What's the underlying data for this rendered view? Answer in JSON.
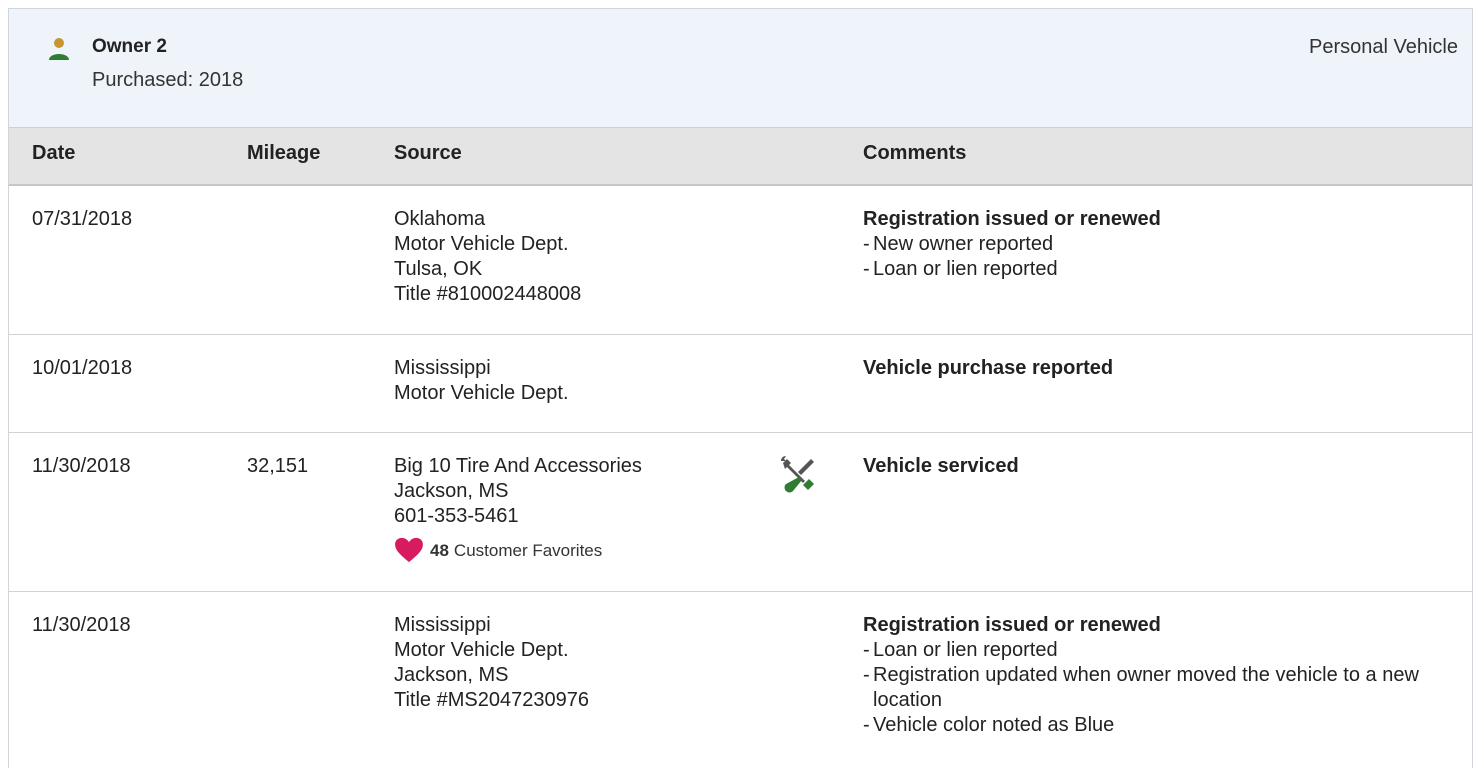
{
  "owner": {
    "title": "Owner 2",
    "purchased": "Purchased: 2018",
    "vehicle_type": "Personal Vehicle",
    "icon": "person-icon"
  },
  "table": {
    "headers": {
      "date": "Date",
      "mileage": "Mileage",
      "source": "Source",
      "comments": "Comments"
    },
    "rows": [
      {
        "date": "07/31/2018",
        "mileage": "",
        "source": [
          "Oklahoma",
          "Motor Vehicle Dept.",
          "Tulsa, OK",
          "Title #810002448008"
        ],
        "comment_title": "Registration issued or renewed",
        "comment_items": [
          "New owner reported",
          "Loan or lien reported"
        ]
      },
      {
        "date": "10/01/2018",
        "mileage": "",
        "source": [
          "Mississippi",
          "Motor Vehicle Dept."
        ],
        "comment_title": "Vehicle purchase reported",
        "comment_items": []
      },
      {
        "date": "11/30/2018",
        "mileage": "32,151",
        "source": [
          "Big 10 Tire And Accessories",
          "Jackson, MS",
          "601-353-5461"
        ],
        "favorites_count": "48",
        "favorites_label": "Customer Favorites",
        "service_icon": "wrench-screwdriver-icon",
        "comment_title": "Vehicle serviced",
        "comment_items": []
      },
      {
        "date": "11/30/2018",
        "mileage": "",
        "source": [
          "Mississippi",
          "Motor Vehicle Dept.",
          "Jackson, MS",
          "Title #MS2047230976"
        ],
        "comment_title": "Registration issued or renewed",
        "comment_items": [
          "Loan or lien reported",
          "Registration updated when owner moved the vehicle to a new location",
          "Vehicle color noted as Blue"
        ]
      }
    ]
  },
  "colors": {
    "header_bg": "#eef4fa",
    "table_head_bg": "#e4e4e4",
    "person_head": "#c8962e",
    "person_body": "#2e7d32",
    "heart": "#d81b60",
    "service_green": "#2e7d32",
    "service_gray": "#555555"
  }
}
